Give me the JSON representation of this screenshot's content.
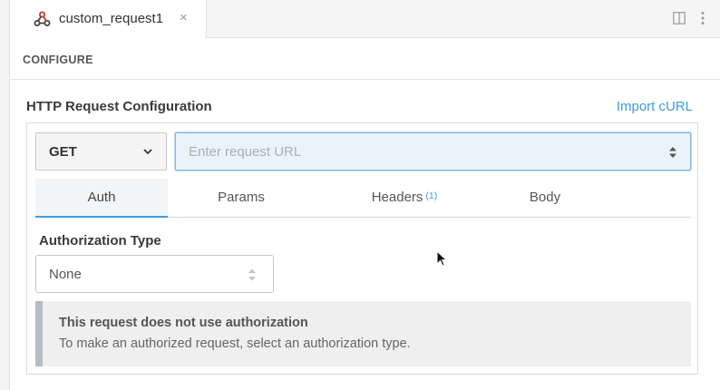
{
  "tab": {
    "title": "custom_request1",
    "close": "×"
  },
  "section": {
    "configure_label": "CONFIGURE",
    "title": "HTTP Request Configuration",
    "import_link": "Import cURL"
  },
  "request": {
    "method": "GET",
    "url_placeholder": "Enter request URL",
    "url_value": ""
  },
  "tabs": [
    {
      "label": "Auth",
      "active": true
    },
    {
      "label": "Params"
    },
    {
      "label": "Headers",
      "badge": "(1)"
    },
    {
      "label": "Body"
    }
  ],
  "auth": {
    "label": "Authorization Type",
    "selected": "None"
  },
  "notice": {
    "title": "This request does not use authorization",
    "description": "To make an authorized request, select an authorization type."
  },
  "colors": {
    "accent": "#3d9be0",
    "notice_bar": "#b6bcc3"
  },
  "icons": [
    "webhook-icon",
    "close-icon",
    "split-view-icon",
    "kebab-menu-icon",
    "chevron-down-icon",
    "sort-updown-icon",
    "mouse-cursor-icon"
  ]
}
